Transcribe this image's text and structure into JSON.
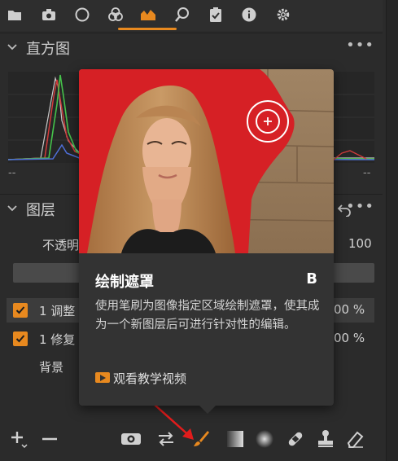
{
  "tabs": [
    {
      "icon": "folder-icon"
    },
    {
      "icon": "camera-icon"
    },
    {
      "icon": "circle-icon"
    },
    {
      "icon": "color-icon"
    },
    {
      "icon": "layers-icon",
      "active": true
    },
    {
      "icon": "search-icon"
    },
    {
      "icon": "clipboard-icon"
    },
    {
      "icon": "info-icon"
    },
    {
      "icon": "gear-icon"
    }
  ],
  "histogram": {
    "title": "直方图",
    "left_label": "--",
    "right_label": "--",
    "more": "•••"
  },
  "layers": {
    "title": "图层",
    "more": "•••",
    "opacity_label": "不透明",
    "opacity_value": "100",
    "rows": [
      {
        "name": "1 调整",
        "percent": "00 %",
        "checked": true
      },
      {
        "name": "1 修复",
        "percent": "00 %",
        "checked": true
      }
    ],
    "background": "背景"
  },
  "tooltip": {
    "title": "绘制遮罩",
    "shortcut": "B",
    "description": "使用笔刷为图像指定区域绘制遮罩，使其成为一个新图层后可进行针对性的编辑。",
    "link": "观看教学视频"
  },
  "colors": {
    "accent": "#e8891f",
    "background": "#2b2b2b",
    "tooltip": "#333333",
    "red_mask": "#d62025"
  }
}
